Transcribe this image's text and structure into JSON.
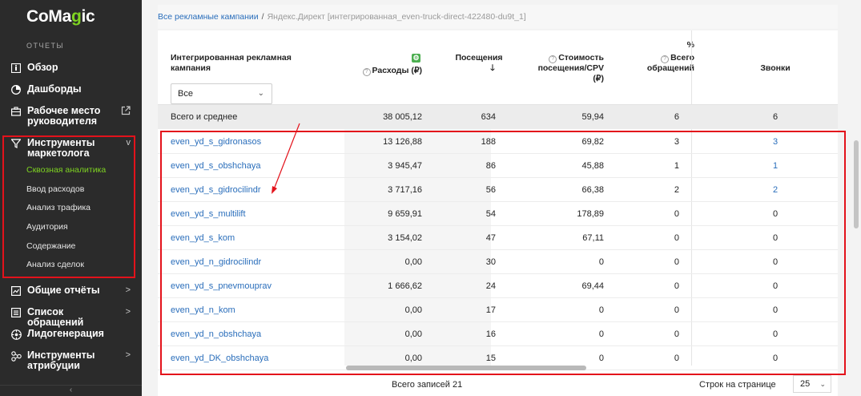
{
  "sidebar": {
    "logo_main": "CoMa",
    "logo_accent": "g",
    "logo_end": "ic",
    "section_label": "ОТЧЕТЫ",
    "items": [
      {
        "label": "Обзор"
      },
      {
        "label": "Дашборды"
      },
      {
        "label": "Рабочее место руководителя"
      },
      {
        "label": "Инструменты маркетолога"
      },
      {
        "label": "Общие отчёты"
      },
      {
        "label": "Список обращений"
      },
      {
        "label": "Лидогенерация"
      },
      {
        "label": "Инструменты атрибуции"
      }
    ],
    "subitems": [
      {
        "label": "Сквозная аналитика"
      },
      {
        "label": "Ввод расходов"
      },
      {
        "label": "Анализ трафика"
      },
      {
        "label": "Аудитория"
      },
      {
        "label": "Содержание"
      },
      {
        "label": "Анализ сделок"
      }
    ],
    "chevron_down": "v",
    "chevron_right": ">",
    "collapse": "‹"
  },
  "breadcrumb": {
    "root": "Все рекламные кампании",
    "separator": "/",
    "current": "Яндекс.Директ [интегрированная_even-truck-direct-422480-du9t_1]"
  },
  "table": {
    "headers": {
      "campaign": "Интегрированная рекламная кампания",
      "expenses": "Расходы (₽)",
      "visits": "Посещения",
      "visits_sort": "🡓",
      "cpv": "Стоимость посещения/CPV (₽)",
      "percent_sign": "%",
      "requests": "Всего обращений",
      "calls": "Звонки"
    },
    "filter_value": "Все",
    "total_row": {
      "name": "Всего и среднее",
      "expenses": "38 005,12",
      "visits": "634",
      "cpv": "59,94",
      "requests": "6",
      "calls": "6"
    },
    "rows": [
      {
        "name": "even_yd_s_gidronasos",
        "expenses": "13 126,88",
        "visits": "188",
        "cpv": "69,82",
        "requests": "3",
        "calls": "3",
        "calls_link": true
      },
      {
        "name": "even_yd_s_obshchaya",
        "expenses": "3 945,47",
        "visits": "86",
        "cpv": "45,88",
        "requests": "1",
        "calls": "1",
        "calls_link": true
      },
      {
        "name": "even_yd_s_gidrocilindr",
        "expenses": "3 717,16",
        "visits": "56",
        "cpv": "66,38",
        "requests": "2",
        "calls": "2",
        "calls_link": true
      },
      {
        "name": "even_yd_s_multilift",
        "expenses": "9 659,91",
        "visits": "54",
        "cpv": "178,89",
        "requests": "0",
        "calls": "0",
        "calls_link": false
      },
      {
        "name": "even_yd_s_kom",
        "expenses": "3 154,02",
        "visits": "47",
        "cpv": "67,11",
        "requests": "0",
        "calls": "0",
        "calls_link": false
      },
      {
        "name": "even_yd_n_gidrocilindr",
        "expenses": "0,00",
        "visits": "30",
        "cpv": "0",
        "requests": "0",
        "calls": "0",
        "calls_link": false
      },
      {
        "name": "even_yd_s_pnevmouprav",
        "expenses": "1 666,62",
        "visits": "24",
        "cpv": "69,44",
        "requests": "0",
        "calls": "0",
        "calls_link": false
      },
      {
        "name": "even_yd_n_kom",
        "expenses": "0,00",
        "visits": "17",
        "cpv": "0",
        "requests": "0",
        "calls": "0",
        "calls_link": false
      },
      {
        "name": "even_yd_n_obshchaya",
        "expenses": "0,00",
        "visits": "16",
        "cpv": "0",
        "requests": "0",
        "calls": "0",
        "calls_link": false
      },
      {
        "name": "even_yd_DK_obshchaya",
        "expenses": "0,00",
        "visits": "15",
        "cpv": "0",
        "requests": "0",
        "calls": "0",
        "calls_link": false
      }
    ]
  },
  "footer": {
    "total_records": "Всего записей 21",
    "rows_per_page_label": "Строк на странице",
    "rows_per_page_value": "25"
  },
  "colors": {
    "sidebar_bg": "#2b2b2b",
    "accent_green": "#7ed321",
    "link_blue": "#2a6ebb",
    "highlight_red": "#e3121b"
  }
}
